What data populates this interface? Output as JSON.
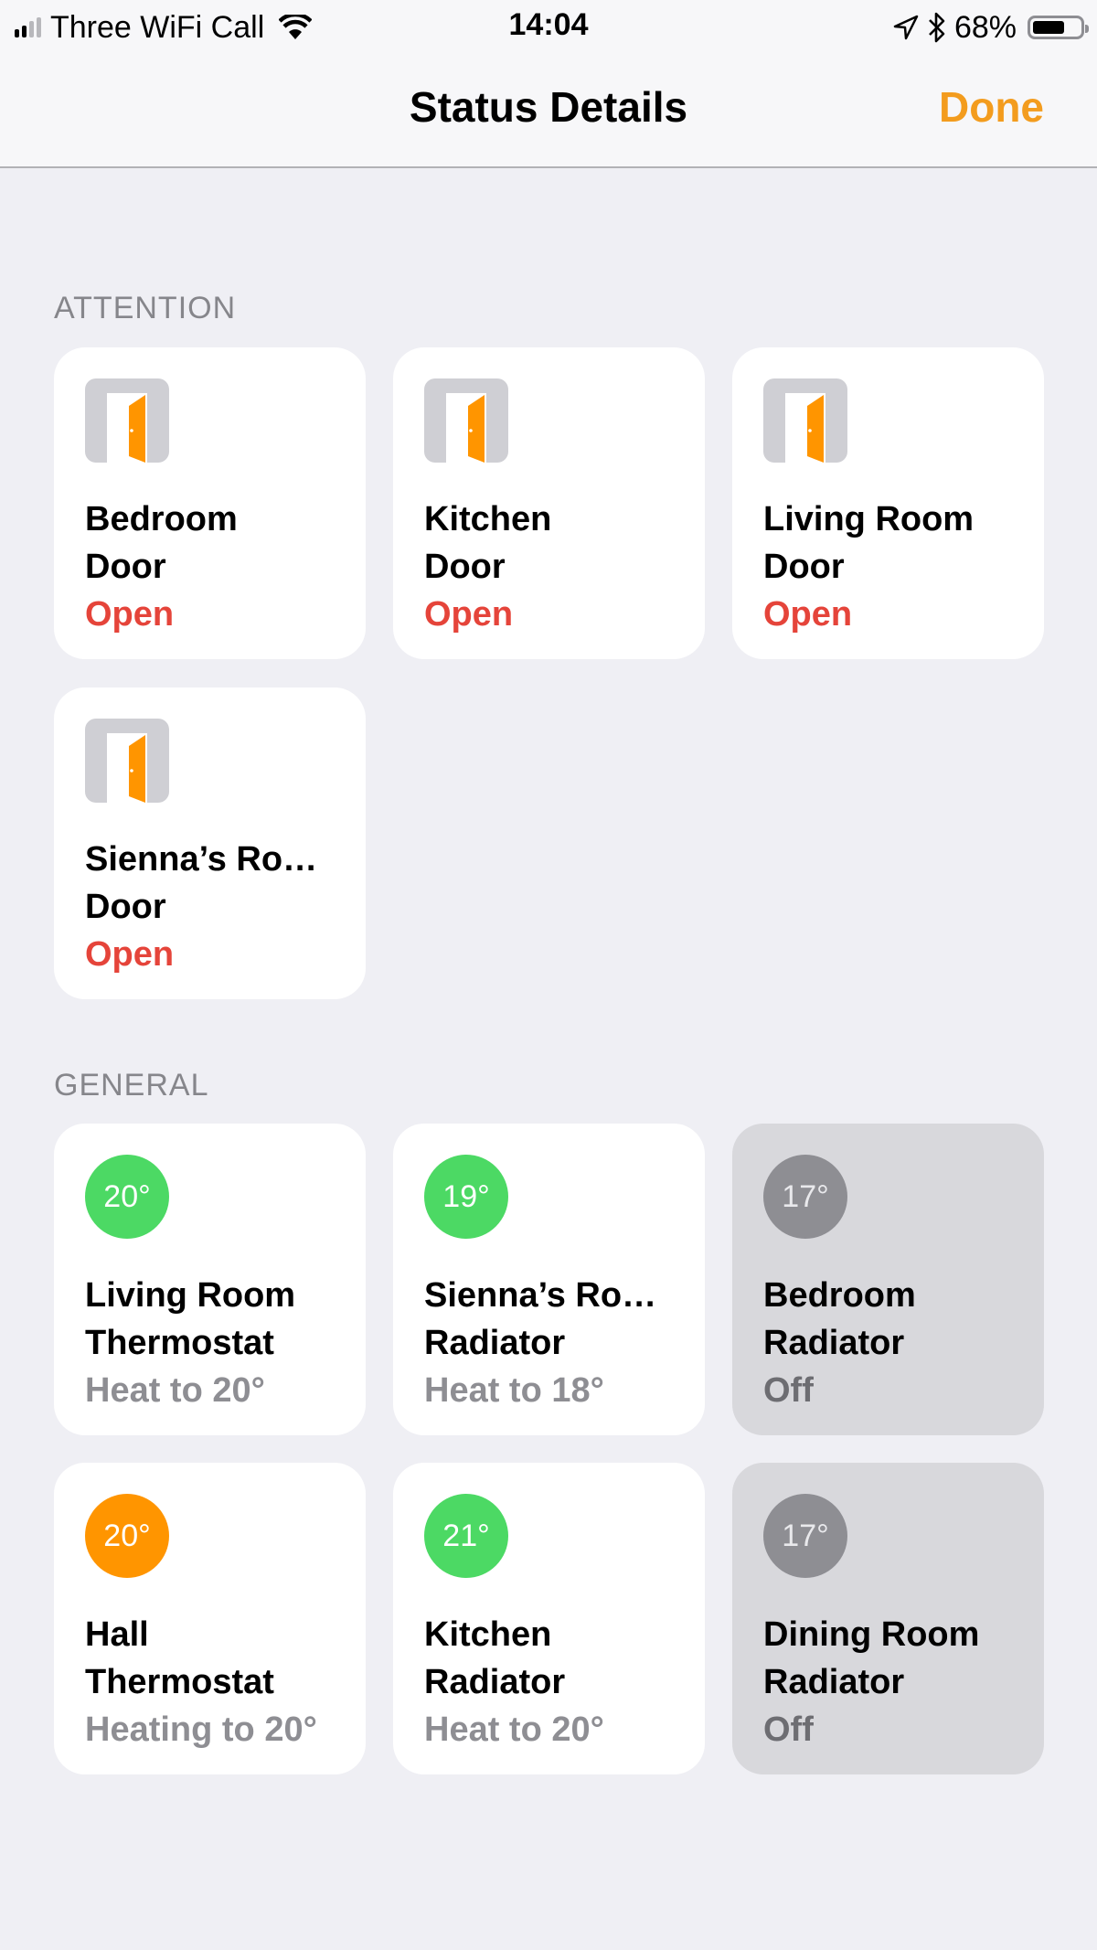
{
  "status_bar": {
    "carrier": "Three WiFi Call",
    "time": "14:04",
    "battery_percent_label": "68%",
    "battery_level": 0.68,
    "signal_bars_filled": 2,
    "signal_bars_total": 4,
    "icons": [
      "signal-icon",
      "wifi-icon",
      "location-arrow-icon",
      "bluetooth-icon",
      "battery-icon"
    ]
  },
  "nav": {
    "title": "Status Details",
    "done_label": "Done"
  },
  "colors": {
    "accent": "#f39c1e",
    "alert_red": "#e5443a",
    "status_gray": "#8e8e93",
    "off_status_gray": "#6d6d72",
    "badge_green": "#4cd964",
    "badge_orange": "#ff9500",
    "badge_gray": "#8e8e93",
    "door_orange": "#ff9500"
  },
  "sections": {
    "attention": {
      "header": "ATTENTION",
      "tiles": [
        {
          "icon": "door-open-icon",
          "name_line1": "Bedroom",
          "name_line2": "Door",
          "status": "Open"
        },
        {
          "icon": "door-open-icon",
          "name_line1": "Kitchen",
          "name_line2": "Door",
          "status": "Open"
        },
        {
          "icon": "door-open-icon",
          "name_line1": "Living Room",
          "name_line2": "Door",
          "status": "Open"
        },
        {
          "icon": "door-open-icon",
          "name_line1": "Sienna’s Ro…",
          "name_line2": "Door",
          "status": "Open"
        }
      ]
    },
    "general": {
      "header": "GENERAL",
      "tiles": [
        {
          "icon": "temperature-badge",
          "temp": "20°",
          "badge": "green",
          "name_line1": "Living Room",
          "name_line2": "Thermostat",
          "status": "Heat to 20°",
          "off": false
        },
        {
          "icon": "temperature-badge",
          "temp": "19°",
          "badge": "green",
          "name_line1": "Sienna’s Ro…",
          "name_line2": "Radiator",
          "status": "Heat to 18°",
          "off": false
        },
        {
          "icon": "temperature-badge",
          "temp": "17°",
          "badge": "gray",
          "name_line1": "Bedroom",
          "name_line2": "Radiator",
          "status": "Off",
          "off": true
        },
        {
          "icon": "temperature-badge",
          "temp": "20°",
          "badge": "orange",
          "name_line1": "Hall",
          "name_line2": "Thermostat",
          "status": "Heating to 20°",
          "off": false
        },
        {
          "icon": "temperature-badge",
          "temp": "21°",
          "badge": "green",
          "name_line1": "Kitchen",
          "name_line2": "Radiator",
          "status": "Heat to 20°",
          "off": false
        },
        {
          "icon": "temperature-badge",
          "temp": "17°",
          "badge": "gray",
          "name_line1": "Dining Room",
          "name_line2": "Radiator",
          "status": "Off",
          "off": true
        }
      ]
    }
  }
}
